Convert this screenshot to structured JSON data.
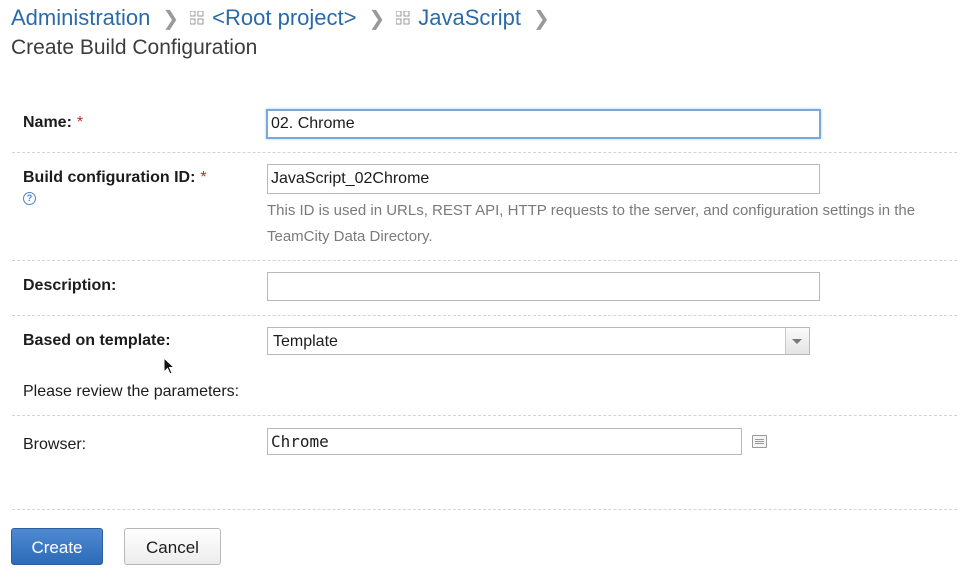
{
  "breadcrumbs": {
    "administration": "Administration",
    "root_project": "<Root project>",
    "javascript": "JavaScript"
  },
  "page_title": "Create Build Configuration",
  "form": {
    "name_label": "Name:",
    "name_value": "02. Chrome",
    "build_id_label": "Build configuration ID:",
    "build_id_value": "JavaScript_02Chrome",
    "build_id_note": "This ID is used in URLs, REST API, HTTP requests to the server, and configuration settings in the TeamCity Data Directory.",
    "description_label": "Description:",
    "description_value": "",
    "template_label": "Based on template:",
    "template_value": "Template",
    "review_text": "Please review the parameters:",
    "browser_label": "Browser:",
    "browser_value": "Chrome",
    "required_marker": "*"
  },
  "buttons": {
    "create": "Create",
    "cancel": "Cancel"
  },
  "colors": {
    "link": "#2b6aa8",
    "required": "#c62828",
    "primary_button": "#2d6bb8"
  }
}
